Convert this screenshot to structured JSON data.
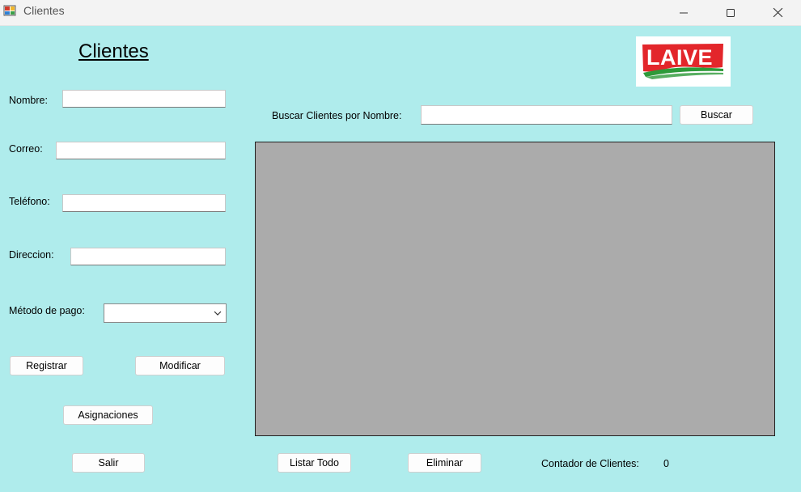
{
  "window": {
    "title": "Clientes"
  },
  "form": {
    "heading": "Clientes",
    "labels": {
      "nombre": "Nombre:",
      "correo": "Correo:",
      "telefono": "Teléfono:",
      "direccion": "Direccion:",
      "metodo_pago": "Método de pago:"
    },
    "fields": {
      "nombre": "",
      "correo": "",
      "telefono": "",
      "direccion": "",
      "metodo_pago": ""
    }
  },
  "buttons": {
    "registrar": "Registrar",
    "modificar": "Modificar",
    "asignaciones": "Asignaciones",
    "salir": "Salir",
    "buscar": "Buscar",
    "listar_todo": "Listar Todo",
    "eliminar": "Eliminar"
  },
  "search": {
    "label": "Buscar Clientes por Nombre:",
    "value": ""
  },
  "counter": {
    "label": "Contador de Clientes:",
    "value": "0"
  },
  "logo": {
    "text": "LAIVE",
    "colors": {
      "red": "#e3262b",
      "green": "#2e9a3a"
    }
  },
  "colors": {
    "background": "#afecec",
    "grid": "#ababab"
  }
}
